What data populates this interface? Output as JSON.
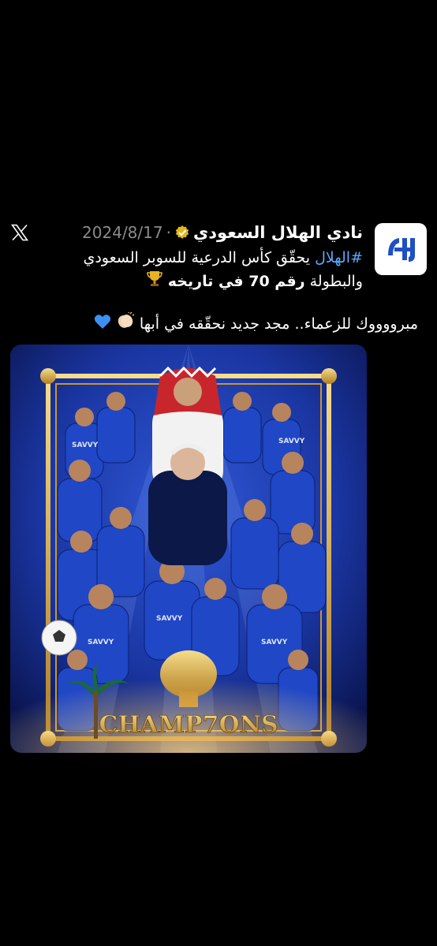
{
  "account": {
    "name": "نادي الهلال السعودي",
    "date": "2024/8/17",
    "separator": "·",
    "avatar_icon": "al-hilal-logo-icon",
    "verified_icon": "verified-badge-icon"
  },
  "post": {
    "hashtag": "#الهلال",
    "line1_rest": " يحقّق كأس الدرعية للسوبر السعودي",
    "line2_a": "والبطولة ",
    "line2_bold": "رقم 70 في تاريخه",
    "trophy_icon": "trophy-icon",
    "line3": "مبرووووك للزعماء.. مجد جديد نحقّقه في أبها",
    "clap_icon": "clapping-hands-icon",
    "heart_icon": "blue-heart-icon"
  },
  "media": {
    "banner_text": "CHAMP7ONS",
    "kit_text": "SAVVY",
    "colors": {
      "primary": "#1d3fae",
      "gold": "#d4a94a",
      "dark": "#0a1550"
    }
  },
  "app": {
    "logo_icon": "x-logo-icon"
  }
}
